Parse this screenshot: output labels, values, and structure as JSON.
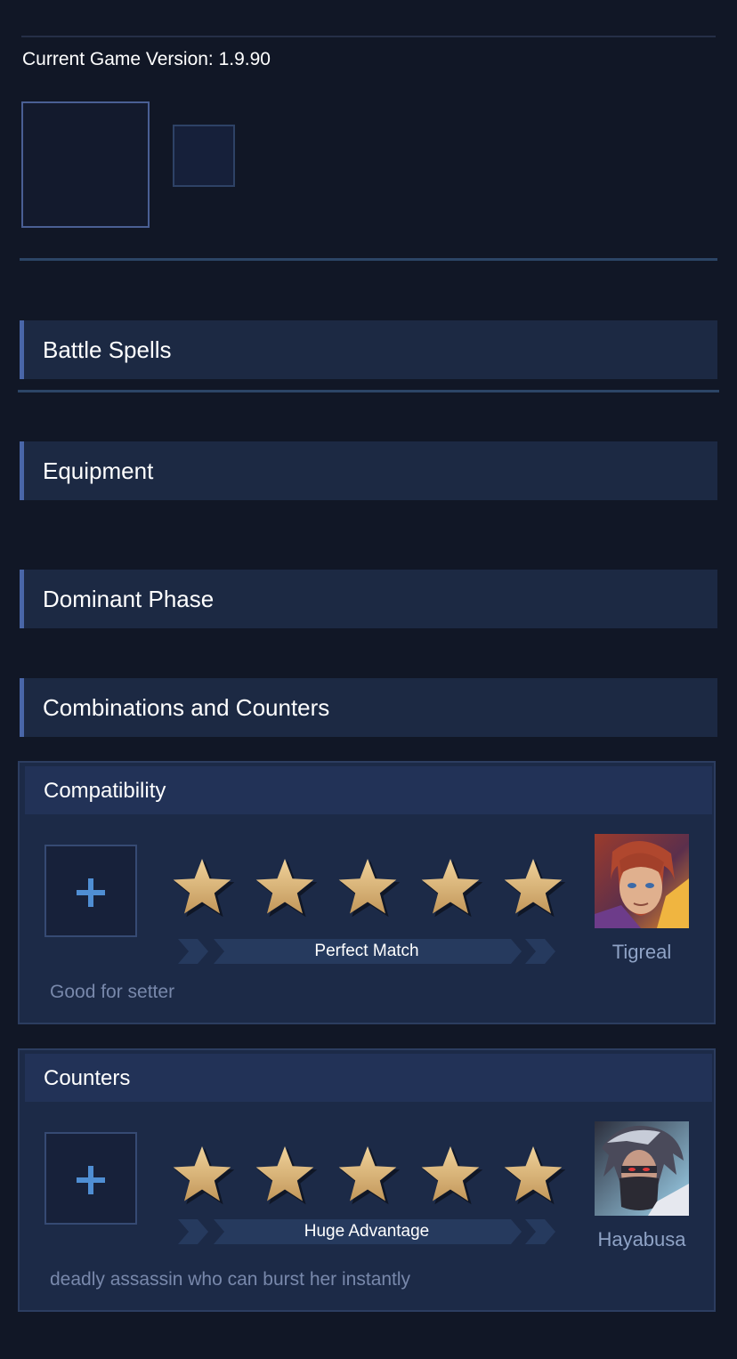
{
  "header": {
    "version_text": "Current Game Version: 1.9.90"
  },
  "sections": {
    "battle_spells": "Battle Spells",
    "equipment": "Equipment",
    "dominant_phase": "Dominant Phase",
    "combinations": "Combinations and Counters"
  },
  "compatibility": {
    "title": "Compatibility",
    "rating_stars": 5,
    "rating_max": 5,
    "rating_label": "Perfect Match",
    "hero_name": "Tigreal",
    "note": "Good for setter"
  },
  "counters": {
    "title": "Counters",
    "rating_stars": 5,
    "rating_max": 5,
    "rating_label": "Huge Advantage",
    "hero_name": "Hayabusa",
    "note": "deadly assassin who can burst her instantly"
  },
  "colors": {
    "background": "#111726",
    "section_header_bg": "#1c2943",
    "accent_bar": "#4966a8",
    "star_gold": "#d9b274",
    "plus_blue": "#4f8ed3",
    "muted_text": "#7888ab"
  },
  "icons": {
    "add": "plus-icon",
    "rating": "star-icon"
  }
}
